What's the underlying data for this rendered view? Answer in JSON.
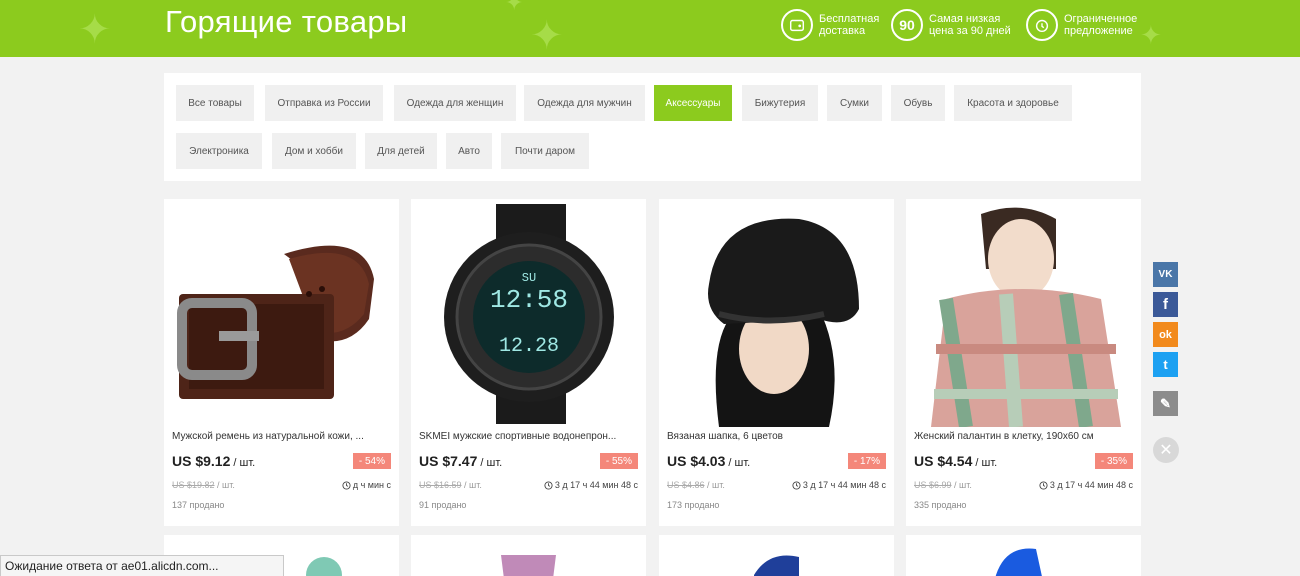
{
  "banner": {
    "title": "Горящие товары",
    "features": [
      {
        "icon": "wallet-icon",
        "label": "Бесплатная доставка",
        "line1": "Бесплатная",
        "line2": "доставка"
      },
      {
        "icon": "ninety-badge-icon",
        "badge": "90",
        "line1": "Самая низкая",
        "line2": "цена за 90 дней"
      },
      {
        "icon": "alarm-clock-icon",
        "line1": "Ограниченное",
        "line2": "предложение"
      }
    ],
    "color": "#8ccb1e"
  },
  "categories": [
    {
      "label": "Все товары",
      "active": false
    },
    {
      "label": "Отправка из России",
      "active": false
    },
    {
      "label": "Одежда для женщин",
      "active": false
    },
    {
      "label": "Одежда для мужчин",
      "active": false
    },
    {
      "label": "Аксессуары",
      "active": true
    },
    {
      "label": "Бижутерия",
      "active": false
    },
    {
      "label": "Сумки",
      "active": false
    },
    {
      "label": "Обувь",
      "active": false
    },
    {
      "label": "Красота и здоровье",
      "active": false
    },
    {
      "label": "Электроника",
      "active": false
    },
    {
      "label": "Дом и хобби",
      "active": false
    },
    {
      "label": "Для детей",
      "active": false
    },
    {
      "label": "Авто",
      "active": false
    },
    {
      "label": "Почти даром",
      "active": false
    }
  ],
  "products": [
    {
      "title": "Мужской ремень из натуральной кожи, ...",
      "price": "US $9.12",
      "unit": " / шт.",
      "discount": "- 54%",
      "old_price": "US $19.82",
      "old_unit": " / шт.",
      "timer": "д ч мин с",
      "sold": "137 продано",
      "image": "belt"
    },
    {
      "title": "SKMEI мужские спортивные водонепрон...",
      "price": "US $7.47",
      "unit": " / шт.",
      "discount": "- 55%",
      "old_price": "US $16.59",
      "old_unit": " / шт.",
      "timer": "3 д 17 ч 44 мин 48 с",
      "sold": "91 продано",
      "image": "watch"
    },
    {
      "title": "Вязаная шапка, 6 цветов",
      "price": "US $4.03",
      "unit": " / шт.",
      "discount": "- 17%",
      "old_price": "US $4.86",
      "old_unit": " / шт.",
      "timer": "3 д 17 ч 44 мин 48 с",
      "sold": "173 продано",
      "image": "hat"
    },
    {
      "title": "Женский палантин в клетку, 190x60 см",
      "price": "US $4.54",
      "unit": " / шт.",
      "discount": "- 35%",
      "old_price": "US $6.99",
      "old_unit": " / шт.",
      "timer": "3 д 17 ч 44 мин 48 с",
      "sold": "335 продано",
      "image": "scarf"
    }
  ],
  "social": [
    {
      "name": "vk-icon",
      "label": "VK",
      "color": "#4a76a8"
    },
    {
      "name": "facebook-icon",
      "label": "f",
      "color": "#3b5998"
    },
    {
      "name": "odnoklassniki-icon",
      "label": "ok",
      "color": "#f28a1c"
    },
    {
      "name": "twitter-icon",
      "label": "t",
      "color": "#1da1f2"
    },
    {
      "name": "edit-pencil-icon",
      "label": "✎",
      "color": "#8c8c8c"
    }
  ],
  "status_bar": {
    "text": "Ожидание ответа от ae01.alicdn.com..."
  },
  "colors": {
    "accent": "#8ccb1e",
    "discount": "#f4877a"
  }
}
